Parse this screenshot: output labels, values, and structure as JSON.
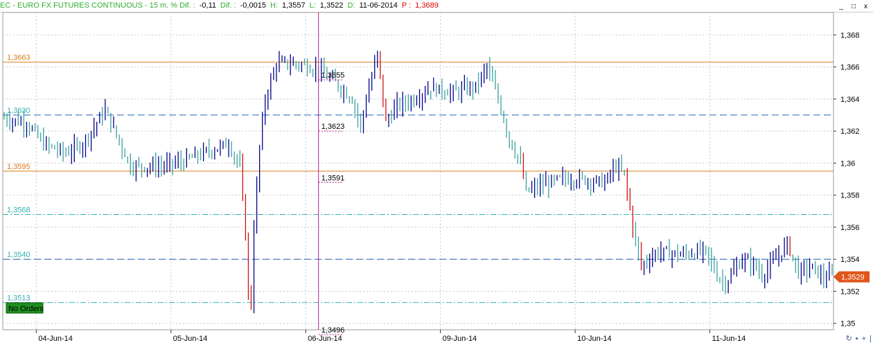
{
  "header": {
    "instrument": "EC - EURO FX FUTURES CONTINUOUS - 15 m. % Dif. :",
    "pct_dif": "-0,11",
    "dif_label": "Dif. :",
    "dif": "-0,0015",
    "high_label": "H:",
    "high": "1,3557",
    "low_label": "L:",
    "low": "1,3522",
    "date_label": "D:",
    "date": "11-06-2014",
    "p_label": "P :",
    "p": "1,3689"
  },
  "window_buttons": [
    "_",
    "□",
    "x"
  ],
  "no_orders_label": "No Orders",
  "colors": {
    "bar_up": "#00008b",
    "bar_down": "#d01010",
    "bar_alt": "#3aa0a0",
    "orange_line": "#d97b1a",
    "dashed_blue": "#2060b0",
    "dashed_cyan": "#30b0b0",
    "cursor": "#b0208f",
    "last_price_bg": "#e0561a",
    "no_orders_bg": "#1f8f1f"
  },
  "chart_data": {
    "type": "candlestick",
    "title": "EC - EURO FX FUTURES CONTINUOUS - 15 m.",
    "ylim": [
      1.3496,
      1.3694
    ],
    "yticks": [
      "1,368",
      "1,366",
      "1,364",
      "1,362",
      "1,36",
      "1,358",
      "1,356",
      "1,354",
      "1,352",
      "1,35"
    ],
    "ytick_values": [
      1.368,
      1.366,
      1.364,
      1.362,
      1.36,
      1.358,
      1.356,
      1.354,
      1.352,
      1.35
    ],
    "x_labels": [
      "04-Jun-14",
      "05-Jun-14",
      "06-Jun-14",
      "09-Jun-14",
      "10-Jun-14",
      "11-Jun-14"
    ],
    "x_label_index": [
      7,
      55,
      103,
      151,
      199,
      247
    ],
    "bar_count": 296,
    "grid": true,
    "horizontal_levels": [
      {
        "label": "1,3663",
        "value": 1.3663,
        "style": "solid-orange"
      },
      {
        "label": "1,3630",
        "value": 1.363,
        "style": "dashed-blue"
      },
      {
        "label": "1,3595",
        "value": 1.3595,
        "style": "solid-orange"
      },
      {
        "label": "1,3568",
        "value": 1.3568,
        "style": "dashed-cyan"
      },
      {
        "label": "1,3540",
        "value": 1.354,
        "style": "dashed-blue"
      },
      {
        "label": "1,3513",
        "value": 1.3513,
        "style": "dashed-cyan"
      }
    ],
    "cursor_labels": [
      {
        "label": "1,3655",
        "value": 1.3655
      },
      {
        "label": "1,3623",
        "value": 1.3623
      },
      {
        "label": "1,3591",
        "value": 1.3591
      },
      {
        "label": "1,3496",
        "value": 1.3496
      }
    ],
    "cursor_bar_index": 112,
    "last_price": {
      "label": "1,3529",
      "value": 1.3529
    },
    "price_path": [
      [
        0,
        1.3628
      ],
      [
        8,
        1.3625
      ],
      [
        14,
        1.3612
      ],
      [
        22,
        1.3606
      ],
      [
        28,
        1.3612
      ],
      [
        36,
        1.3633
      ],
      [
        45,
        1.3598
      ],
      [
        56,
        1.3598
      ],
      [
        64,
        1.3601
      ],
      [
        72,
        1.3607
      ],
      [
        80,
        1.3612
      ],
      [
        84,
        1.3598
      ],
      [
        86,
        1.3555
      ],
      [
        87,
        1.352
      ],
      [
        88,
        1.3512
      ],
      [
        89,
        1.356
      ],
      [
        91,
        1.361
      ],
      [
        93,
        1.364
      ],
      [
        97,
        1.3662
      ],
      [
        105,
        1.3662
      ],
      [
        112,
        1.3658
      ],
      [
        118,
        1.365
      ],
      [
        124,
        1.364
      ],
      [
        127,
        1.3623
      ],
      [
        129,
        1.364
      ],
      [
        133,
        1.3668
      ],
      [
        136,
        1.3625
      ],
      [
        140,
        1.3636
      ],
      [
        146,
        1.364
      ],
      [
        152,
        1.3647
      ],
      [
        160,
        1.3644
      ],
      [
        168,
        1.3648
      ],
      [
        172,
        1.366
      ],
      [
        176,
        1.364
      ],
      [
        180,
        1.3615
      ],
      [
        184,
        1.36
      ],
      [
        186,
        1.3582
      ],
      [
        190,
        1.3585
      ],
      [
        198,
        1.359
      ],
      [
        206,
        1.359
      ],
      [
        214,
        1.3588
      ],
      [
        218,
        1.3598
      ],
      [
        221,
        1.3593
      ],
      [
        224,
        1.356
      ],
      [
        227,
        1.3536
      ],
      [
        233,
        1.3545
      ],
      [
        241,
        1.3543
      ],
      [
        250,
        1.3545
      ],
      [
        254,
        1.353
      ],
      [
        257,
        1.3525
      ],
      [
        263,
        1.354
      ],
      [
        267,
        1.3537
      ],
      [
        270,
        1.353
      ],
      [
        275,
        1.354
      ],
      [
        279,
        1.355
      ],
      [
        283,
        1.3532
      ],
      [
        288,
        1.3535
      ],
      [
        292,
        1.3528
      ],
      [
        295,
        1.353
      ]
    ]
  }
}
